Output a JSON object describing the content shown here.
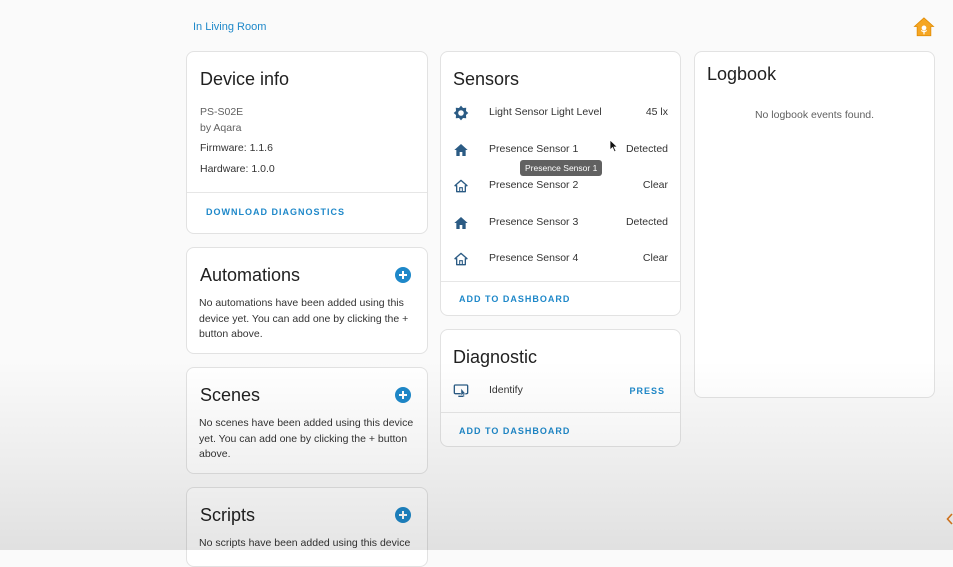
{
  "breadcrumb": {
    "area": "In Living Room"
  },
  "colors": {
    "accent": "#1e88c9",
    "home": "#f5a623",
    "icon": "#2b5b84"
  },
  "device_info": {
    "title": "Device info",
    "model": "PS-S02E",
    "manufacturer": "by Aqara",
    "firmware": "Firmware: 1.1.6",
    "hardware": "Hardware: 1.0.0",
    "download_label": "DOWNLOAD DIAGNOSTICS",
    "menu_icon": "dots-vertical-icon"
  },
  "automations": {
    "title": "Automations",
    "description": "No automations have been added using this device yet. You can add one by clicking the + button above."
  },
  "scenes": {
    "title": "Scenes",
    "description": "No scenes have been added using this device yet. You can add one by clicking the + button above."
  },
  "scripts": {
    "title": "Scripts",
    "description": "No scripts have been added using this device"
  },
  "sensors": {
    "title": "Sensors",
    "items": [
      {
        "name": "Light Sensor Light Level",
        "state": "45 lx",
        "icon": "brightness-icon"
      },
      {
        "name": "Presence Sensor 1",
        "state": "Detected",
        "icon": "home-filled-icon"
      },
      {
        "name": "Presence Sensor 2",
        "state": "Clear",
        "icon": "home-outline-icon"
      },
      {
        "name": "Presence Sensor 3",
        "state": "Detected",
        "icon": "home-filled-icon"
      },
      {
        "name": "Presence Sensor 4",
        "state": "Clear",
        "icon": "home-outline-icon"
      }
    ],
    "add_label": "ADD TO DASHBOARD",
    "tooltip": "Presence Sensor 1"
  },
  "diagnostic": {
    "title": "Diagnostic",
    "item_name": "Identify",
    "item_icon": "identify-icon",
    "press_label": "PRESS",
    "add_label": "ADD TO DASHBOARD"
  },
  "logbook": {
    "title": "Logbook",
    "empty": "No logbook events found."
  }
}
